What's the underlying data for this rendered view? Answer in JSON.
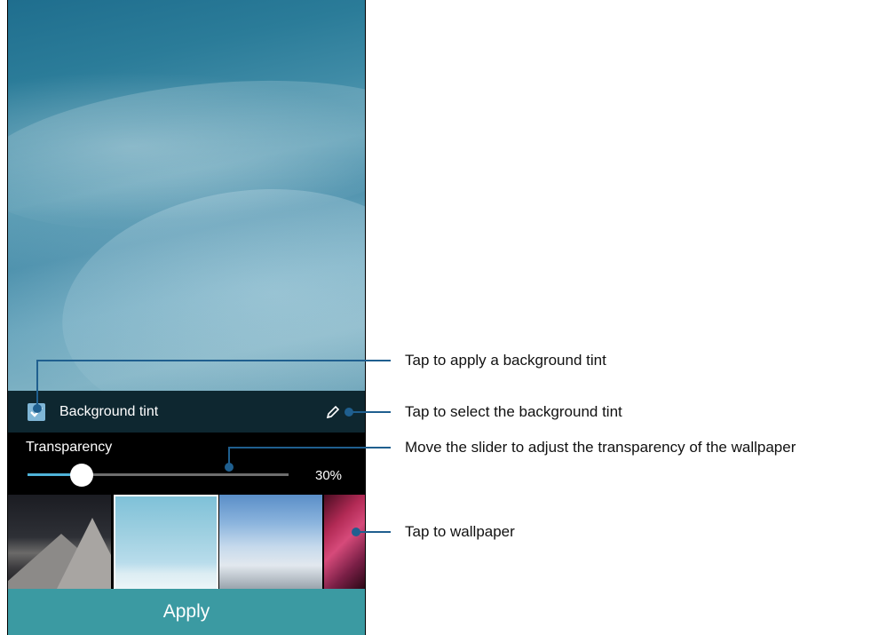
{
  "screen": {
    "tint_label": "Background tint",
    "tint_checked": true,
    "transparency_label": "Transparency",
    "transparency_value_text": "30%",
    "transparency_level": 0.16,
    "apply_label": "Apply",
    "selected_wallpaper_index": 1,
    "wallpapers": [
      "mountain-dusk",
      "snow-dunes",
      "snow-mountains",
      "red-canyon"
    ],
    "accent_color": "#3b9aa2"
  },
  "callouts": [
    {
      "text": "Tap to apply a background tint"
    },
    {
      "text": "Tap to select the background tint"
    },
    {
      "text": "Move the slider to adjust the transparency of the wallpaper"
    },
    {
      "text": "Tap to wallpaper"
    }
  ]
}
